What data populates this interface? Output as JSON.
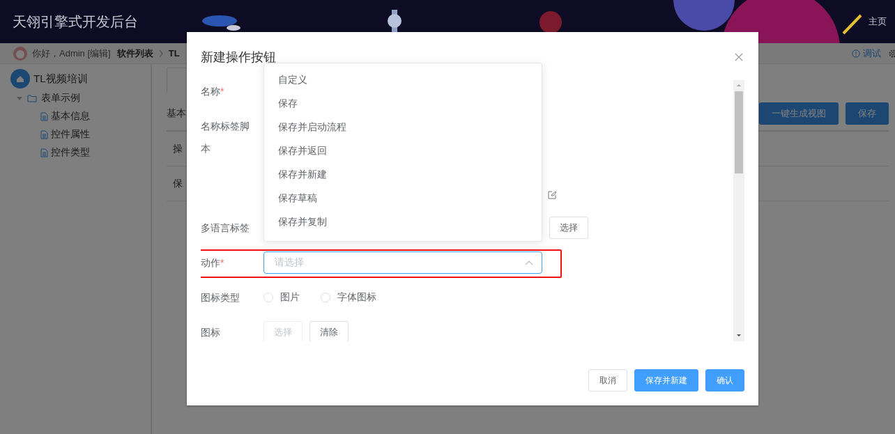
{
  "header": {
    "title": "天翎引擎式开发后台",
    "links": [
      "主页"
    ]
  },
  "breadcrumb": {
    "greeting": "你好，Admin [编辑]",
    "items": [
      "软件列表",
      "TL"
    ],
    "actions": [
      "调试"
    ]
  },
  "sidebar": {
    "tree": [
      {
        "label": "TL视频培训",
        "children": [
          {
            "label": "表单示例",
            "expanded": true,
            "children": [
              {
                "label": "基本信息"
              },
              {
                "label": "控件属性"
              },
              {
                "label": "控件类型"
              }
            ]
          }
        ]
      }
    ]
  },
  "main": {
    "tabs": [
      {
        "selected": true
      }
    ],
    "section_title": "基本",
    "buttons": [
      {
        "label": "一键生成视图"
      },
      {
        "label": "保存"
      }
    ],
    "rows": [
      "操",
      "保"
    ]
  },
  "dialog": {
    "title": "新建操作按钮",
    "fields": [
      {
        "kind": "text",
        "label": "名称",
        "required_mark": "*"
      },
      {
        "kind": "script",
        "label": "名称标签脚本"
      },
      {
        "kind": "picker",
        "label": "多语言标签",
        "button": "选择"
      },
      {
        "kind": "select",
        "label": "动作",
        "required_mark": "*",
        "placeholder": "请选择",
        "open": true,
        "highlighted": true
      },
      {
        "kind": "radio",
        "label": "图标类型",
        "options": [
          {
            "label": "图片",
            "selected": false
          },
          {
            "label": "字体图标",
            "selected": false
          }
        ]
      },
      {
        "kind": "buttons",
        "label": "图标",
        "buttons": [
          {
            "label": "选择",
            "disabled": true
          },
          {
            "label": "清除",
            "disabled": false
          }
        ]
      }
    ],
    "dropdown": {
      "options": [
        {
          "label": "自定义",
          "selected": false
        },
        {
          "label": "保存",
          "selected": false
        },
        {
          "label": "保存并启动流程",
          "selected": false
        },
        {
          "label": "保存并返回",
          "selected": false
        },
        {
          "label": "保存并新建",
          "selected": false
        },
        {
          "label": "保存草稿",
          "selected": false
        },
        {
          "label": "保存并复制",
          "selected": false
        }
      ]
    },
    "footer_buttons": [
      {
        "label": "取消",
        "kind": "default"
      },
      {
        "label": "保存并新建",
        "kind": "primary"
      },
      {
        "label": "确认",
        "kind": "primary"
      }
    ]
  }
}
